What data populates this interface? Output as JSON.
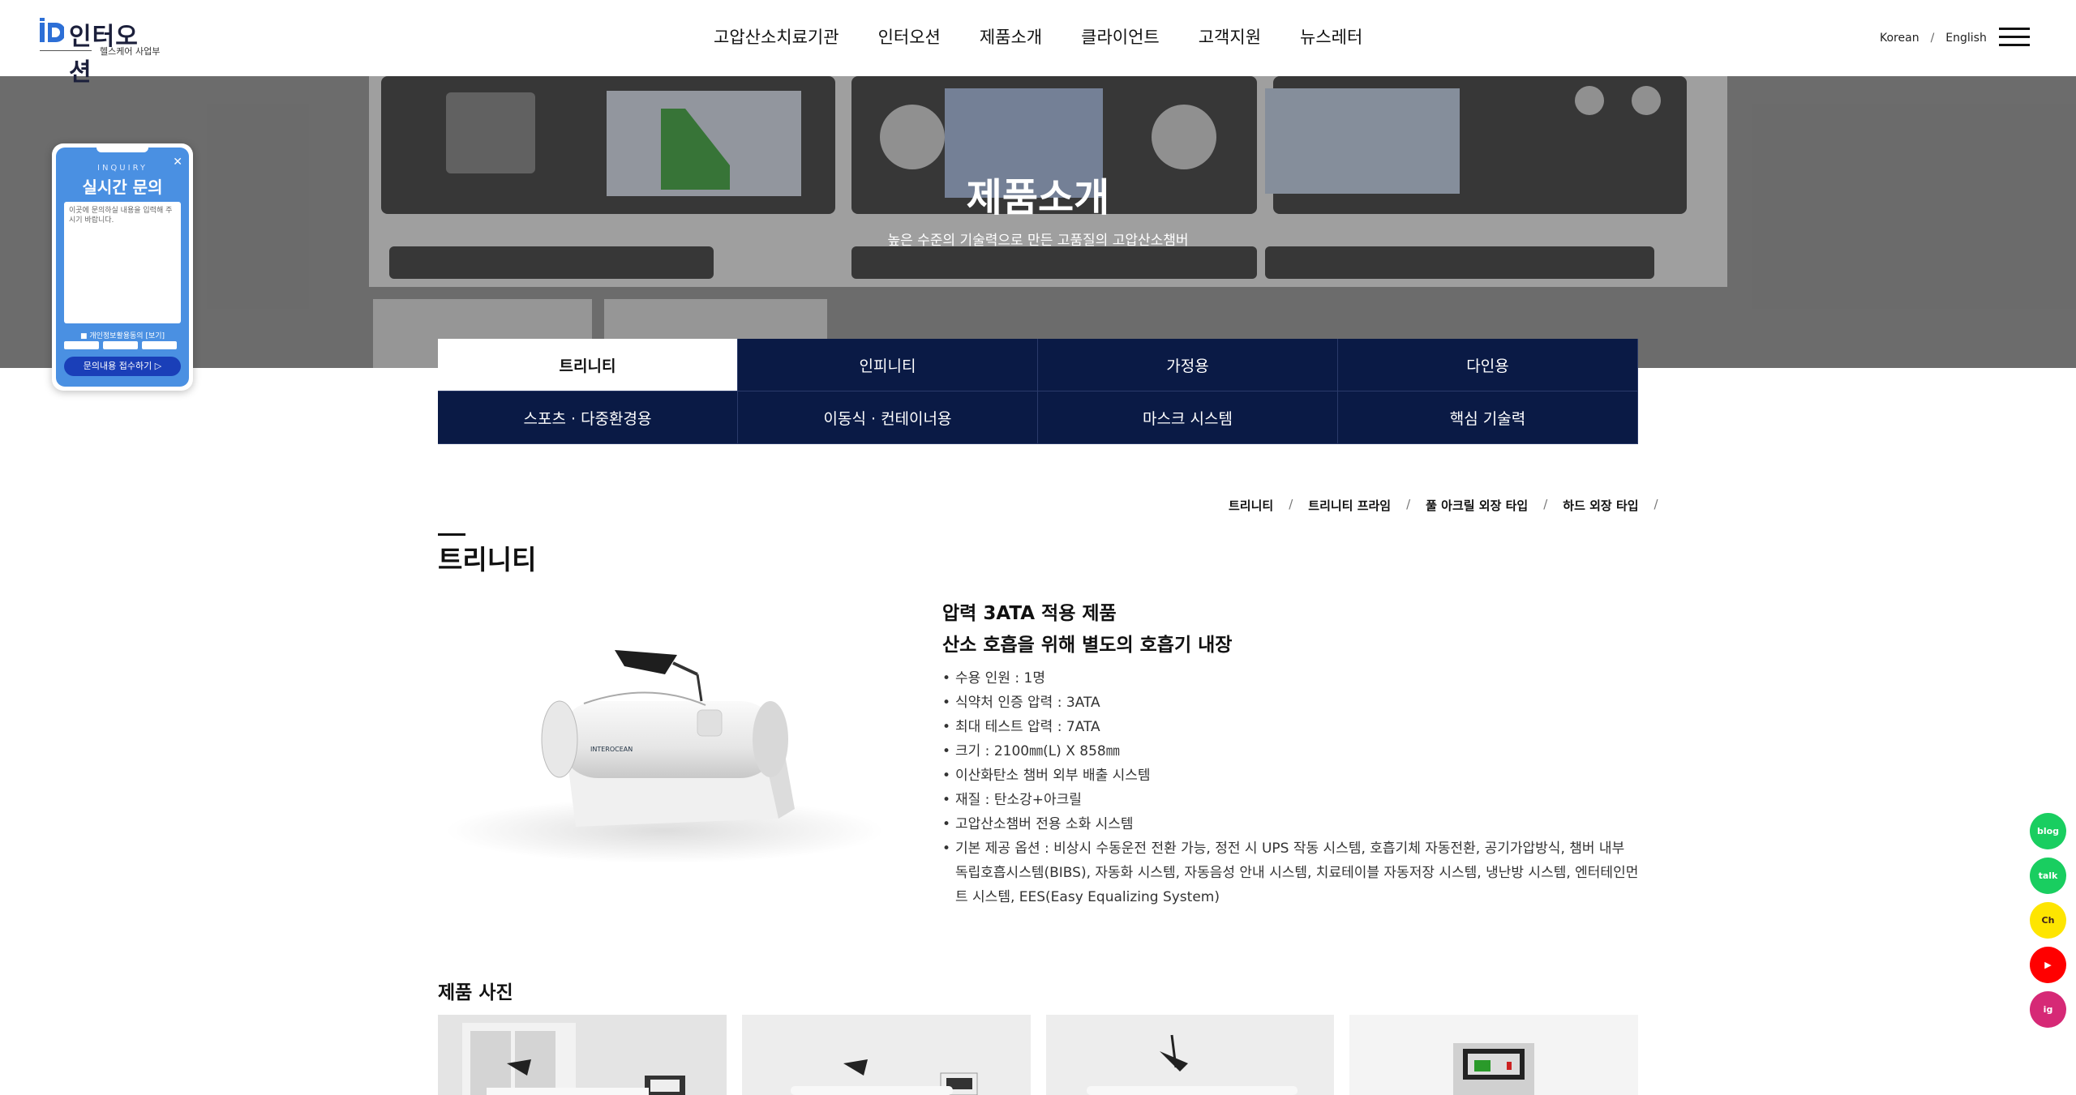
{
  "header": {
    "logo_text": "인터오션",
    "logo_sub": "헬스케어 사업부",
    "nav": [
      "고압산소치료기관",
      "인터오션",
      "제품소개",
      "클라이언트",
      "고객지원",
      "뉴스레터"
    ],
    "lang": [
      "Korean",
      "English"
    ],
    "lang_sep": "/"
  },
  "hero": {
    "title": "제품소개",
    "subtitle": "높은 수준의 기술력으로 만든 고품질의 고압산소챔버"
  },
  "inquiry": {
    "small": "INQUIRY",
    "title": "실시간 문의",
    "placeholder": "이곳에 문의하실 내용을 입력해 주시기 바랍니다.",
    "agree": "개인정보활용동의 [보기]",
    "submit": "문의내용 접수하기"
  },
  "tabs": [
    "트리니티",
    "인피니티",
    "가정용",
    "다인용",
    "스포츠 · 다중환경용",
    "이동식 · 컨테이너용",
    "마스크 시스템",
    "핵심 기술력"
  ],
  "breadcrumb": [
    "트리니티",
    "트리니티 프라임",
    "풀 아크릴 외장 타입",
    "하드 외장 타입"
  ],
  "breadcrumb_sep": "/",
  "section_title": "트리니티",
  "product": {
    "head1": "압력 3ATA 적용 제품",
    "head2": "산소 호흡을 위해 별도의 호흡기 내장",
    "brand": "INTEROCEAN",
    "specs": [
      "수용 인원 : 1명",
      "식약처 인증 압력 : 3ATA",
      "최대 테스트 압력 : 7ATA",
      "크기 : 2100㎜(L) X 858㎜",
      "이산화탄소 챔버 외부 배출 시스템",
      "재질 : 탄소강+아크릴",
      "고압산소챔버 전용 소화 시스템",
      "기본 제공 옵션 : 비상시 수동운전 전환 가능, 정전 시 UPS 작동 시스템, 호흡기체 자동전환, 공기가압방식, 챔버 내부 독립호흡시스템(BIBS), 자동화 시스템, 자동음성 안내 시스템, 치료테이블 자동저장 시스템, 냉난방 시스템, 엔터테인먼트 시스템, EES(Easy Equalizing System)"
    ]
  },
  "photos_title": "제품 사진",
  "social": [
    {
      "icon": "blog-icon",
      "label": "blog",
      "color": "#19ce60"
    },
    {
      "icon": "talk-icon",
      "label": "talk",
      "color": "#19ce60"
    },
    {
      "icon": "kakao-channel-icon",
      "label": "Ch",
      "color": "#fee500"
    },
    {
      "icon": "youtube-icon",
      "label": "▶",
      "color": "#ff0000"
    },
    {
      "icon": "instagram-icon",
      "label": "ig",
      "color": "#d62976"
    }
  ]
}
